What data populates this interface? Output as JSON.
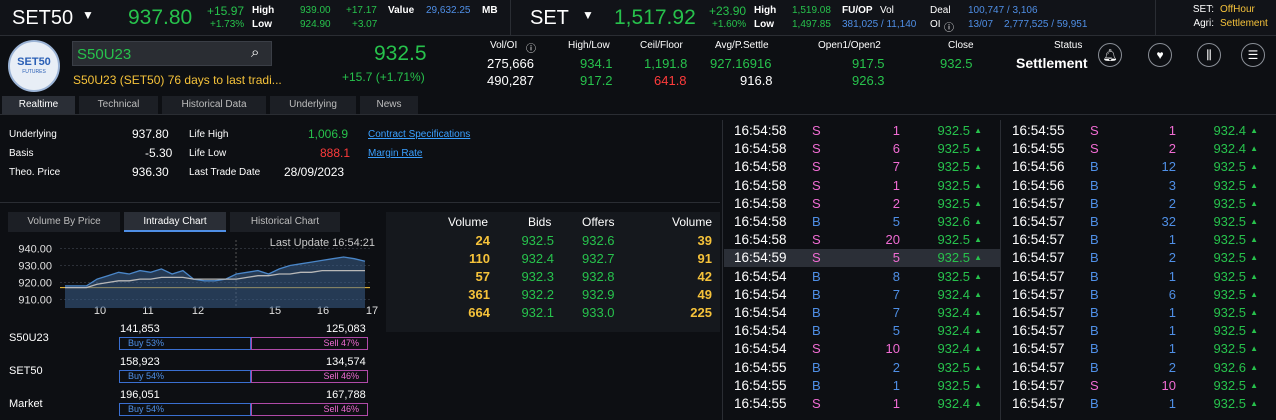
{
  "header": {
    "sym1": "SET50",
    "sym1_price": "937.80",
    "sym1_chg": "+15.97",
    "sym1_pct": "+1.73%",
    "high_l": "High",
    "low_l": "Low",
    "sym1_high": "939.00",
    "sym1_high_chg": "+17.17",
    "sym1_low": "924.90",
    "sym1_low_chg": "+3.07",
    "value_l": "Value",
    "sym1_value": "29,632.25",
    "mb_l": "MB",
    "sym2": "SET",
    "sym2_price": "1,517.92",
    "sym2_chg": "+23.90",
    "sym2_pct": "+1.60%",
    "sym2_high": "1,519.08",
    "sym2_low": "1,497.85",
    "fuop_l": "FU/OP",
    "vol_l": "Vol",
    "oi_l": "OI",
    "deal_l": "Deal",
    "vol_val": "381,025 / 11,140",
    "oi_val": "13/07",
    "deal_val": "100,747 / 3,106",
    "deal2_val": "2,777,525 / 59,951",
    "set_l": "SET:",
    "set_status": "OffHour",
    "agri_l": "Agri:",
    "agri_status": "Settlement"
  },
  "quote": {
    "logo": "SET50",
    "logo_sub": "FUTURES",
    "search_value": "S50U23",
    "desc": "S50U23 (SET50) 76 days to last tradi...",
    "price": "932.5",
    "chg": "+15.7 (+1.71%)",
    "h_voloi": "Vol/OI",
    "h_hl": "High/Low",
    "h_cf": "Ceil/Floor",
    "h_avg": "Avg/P.Settle",
    "h_open": "Open1/Open2",
    "h_close": "Close",
    "h_status": "Status",
    "vol": "275,666",
    "oi": "490,287",
    "high": "934.1",
    "low": "917.2",
    "ceil": "1,191.8",
    "floor": "641.8",
    "avg": "927.16916",
    "psettle": "916.8",
    "open1": "917.5",
    "open2": "926.3",
    "close": "932.5",
    "status": "Settlement"
  },
  "tabs": [
    "Realtime",
    "Technical",
    "Historical Data",
    "Underlying",
    "News"
  ],
  "info": {
    "underlying_l": "Underlying",
    "underlying": "937.80",
    "basis_l": "Basis",
    "basis": "-5.30",
    "theo_l": "Theo. Price",
    "theo": "936.30",
    "lh_l": "Life High",
    "lh": "1,006.9",
    "ll_l": "Life Low",
    "ll": "888.1",
    "ltd_l": "Last Trade Date",
    "ltd": "28/09/2023",
    "spec_link": "Contract Specifications",
    "margin_link": "Margin Rate"
  },
  "charttabs": [
    "Volume By Price",
    "Intraday Chart",
    "Historical Chart"
  ],
  "chart_data": {
    "type": "line",
    "title": "Last Update 16:54:21",
    "yticks": [
      "940.00",
      "930.00",
      "920.00",
      "910.00"
    ],
    "xticks": [
      "10",
      "11",
      "12",
      "15",
      "16",
      "17"
    ],
    "ylim": [
      905,
      945
    ],
    "series": [
      {
        "values": [
          918,
          918,
          918,
          922,
          924,
          926,
          925,
          927,
          926,
          928,
          925,
          927,
          922,
          921,
          921,
          922,
          925,
          926,
          927,
          925,
          928,
          930,
          931,
          932,
          933,
          934,
          935,
          934,
          932.5
        ]
      },
      {
        "values": [
          917,
          917,
          917,
          919,
          920,
          921,
          921,
          922,
          922,
          923,
          923,
          923,
          922,
          922,
          922,
          922,
          922,
          923,
          924,
          924,
          925,
          925,
          926,
          926,
          927,
          927,
          927,
          927,
          927
        ]
      }
    ]
  },
  "book": {
    "h_volume": "Volume",
    "h_bids": "Bids",
    "h_offers": "Offers",
    "h_volume2": "Volume",
    "rows": [
      {
        "bv": "24",
        "bid": "932.5",
        "offer": "932.6",
        "ov": "39"
      },
      {
        "bv": "110",
        "bid": "932.4",
        "offer": "932.7",
        "ov": "91"
      },
      {
        "bv": "57",
        "bid": "932.3",
        "offer": "932.8",
        "ov": "42"
      },
      {
        "bv": "361",
        "bid": "932.2",
        "offer": "932.9",
        "ov": "49"
      },
      {
        "bv": "664",
        "bid": "932.1",
        "offer": "933.0",
        "ov": "225"
      }
    ]
  },
  "buysell": [
    {
      "name": "S50U23",
      "buy": "141,853",
      "sell": "125,083",
      "buy_l": "Buy 53%",
      "sell_l": "Sell 47%",
      "pct": 53
    },
    {
      "name": "SET50",
      "buy": "158,923",
      "sell": "134,574",
      "buy_l": "Buy 54%",
      "sell_l": "Sell 46%",
      "pct": 54
    },
    {
      "name": "Market",
      "buy": "196,051",
      "sell": "167,788",
      "buy_l": "Buy 54%",
      "sell_l": "Sell 46%",
      "pct": 54
    }
  ],
  "ticks_left": [
    [
      "16:54:58",
      "S",
      "1",
      "932.5"
    ],
    [
      "16:54:58",
      "S",
      "6",
      "932.5"
    ],
    [
      "16:54:58",
      "S",
      "7",
      "932.5"
    ],
    [
      "16:54:58",
      "S",
      "1",
      "932.5"
    ],
    [
      "16:54:58",
      "S",
      "2",
      "932.5"
    ],
    [
      "16:54:58",
      "B",
      "5",
      "932.6"
    ],
    [
      "16:54:58",
      "S",
      "20",
      "932.5"
    ],
    [
      "16:54:59",
      "S",
      "5",
      "932.5"
    ],
    [
      "16:54:54",
      "B",
      "8",
      "932.5"
    ],
    [
      "16:54:54",
      "B",
      "7",
      "932.4"
    ],
    [
      "16:54:54",
      "B",
      "7",
      "932.4"
    ],
    [
      "16:54:54",
      "B",
      "5",
      "932.4"
    ],
    [
      "16:54:54",
      "S",
      "10",
      "932.4"
    ],
    [
      "16:54:55",
      "B",
      "2",
      "932.5"
    ],
    [
      "16:54:55",
      "B",
      "1",
      "932.5"
    ],
    [
      "16:54:55",
      "S",
      "1",
      "932.4"
    ]
  ],
  "ticks_right": [
    [
      "16:54:55",
      "S",
      "1",
      "932.4"
    ],
    [
      "16:54:55",
      "S",
      "2",
      "932.4"
    ],
    [
      "16:54:56",
      "B",
      "12",
      "932.5"
    ],
    [
      "16:54:56",
      "B",
      "3",
      "932.5"
    ],
    [
      "16:54:57",
      "B",
      "2",
      "932.5"
    ],
    [
      "16:54:57",
      "B",
      "32",
      "932.5"
    ],
    [
      "16:54:57",
      "B",
      "1",
      "932.5"
    ],
    [
      "16:54:57",
      "B",
      "2",
      "932.5"
    ],
    [
      "16:54:57",
      "B",
      "1",
      "932.5"
    ],
    [
      "16:54:57",
      "B",
      "6",
      "932.5"
    ],
    [
      "16:54:57",
      "B",
      "1",
      "932.5"
    ],
    [
      "16:54:57",
      "B",
      "1",
      "932.5"
    ],
    [
      "16:54:57",
      "B",
      "1",
      "932.5"
    ],
    [
      "16:54:57",
      "B",
      "2",
      "932.6"
    ],
    [
      "16:54:57",
      "S",
      "10",
      "932.5"
    ],
    [
      "16:54:57",
      "B",
      "1",
      "932.5"
    ]
  ]
}
